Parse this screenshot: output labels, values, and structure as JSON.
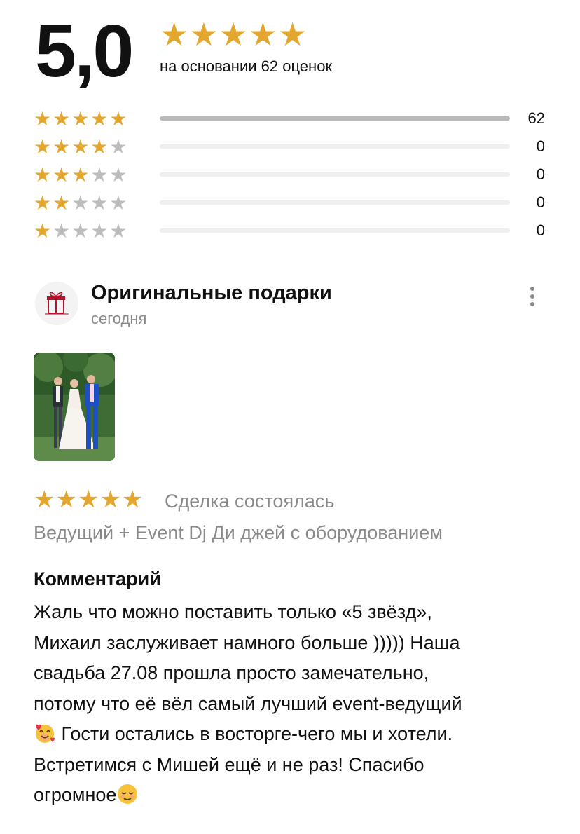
{
  "summary": {
    "score": "5,0",
    "stars": "★★★★★",
    "note": "на основании 62 оценок"
  },
  "distribution": [
    {
      "stars_on": "★★★★★",
      "stars_off": "",
      "count": "62",
      "fraction": 1.0
    },
    {
      "stars_on": "★★★★",
      "stars_off": "★",
      "count": "0",
      "fraction": 0
    },
    {
      "stars_on": "★★★",
      "stars_off": "★★",
      "count": "0",
      "fraction": 0
    },
    {
      "stars_on": "★★",
      "stars_off": "★★★",
      "count": "0",
      "fraction": 0
    },
    {
      "stars_on": "★",
      "stars_off": "★★★★",
      "count": "0",
      "fraction": 0
    }
  ],
  "review": {
    "author": "Оригинальные подарки",
    "date": "сегодня",
    "avatar_icon": "gift-logo-icon",
    "photo_icon": "wedding-photo",
    "rating_stars": "★★★★★",
    "rating": 5,
    "deal_status": "Сделка состоялась",
    "service": "Ведущий + Event Dj Ди джей с оборудованием",
    "comment_label": "Комментарий",
    "comment_lines": [
      "Жаль что можно поставить только «5 звёзд»,",
      "Михаил заслуживает намного больше ))))) Наша",
      "свадьба 27.08 прошла просто замечательно,",
      "потому что её вёл самый лучший event-ведущий",
      " Гости остались в восторге-чего мы и хотели.",
      "Встретимся с Мишей ещё и не раз! Спасибо",
      "огромное"
    ],
    "emoji_icons": [
      "smiling-face-with-hearts-emoji",
      "relieved-face-emoji"
    ]
  },
  "colors": {
    "star_active": "#E3A72F",
    "star_inactive": "#BDBDBD",
    "bar_track": "#EFEFEF",
    "bar_fill": "#B9B9B9",
    "muted_text": "#8A8A8A"
  }
}
